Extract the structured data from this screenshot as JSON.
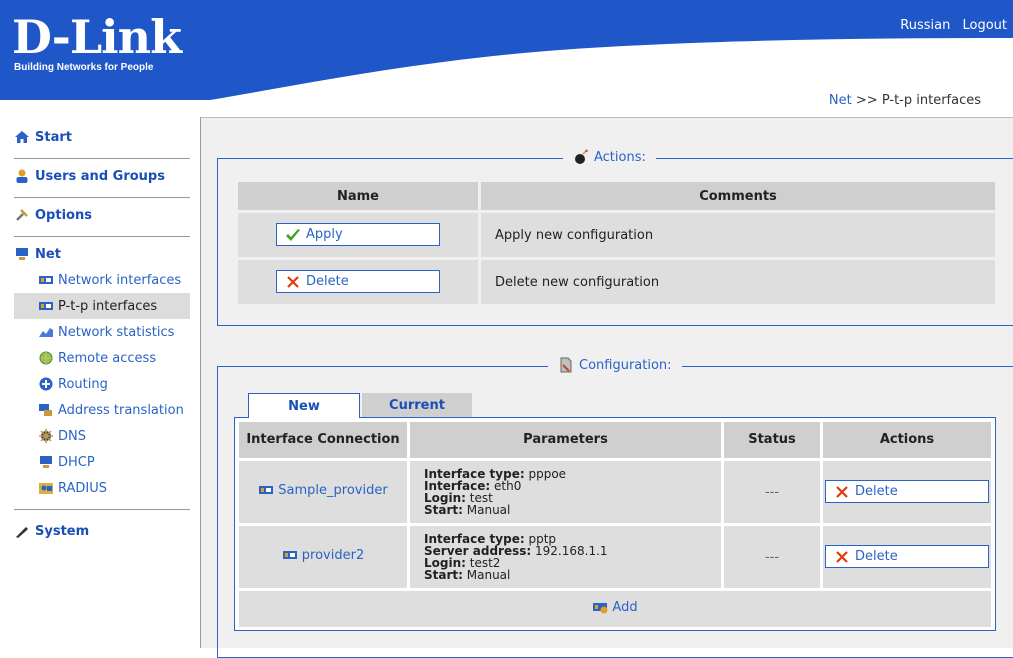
{
  "brand": {
    "name": "D-Link",
    "tagline": "Building Networks for People"
  },
  "top_links": {
    "language": "Russian",
    "logout": "Logout"
  },
  "breadcrumb": {
    "parent": "Net",
    "separator": ">>",
    "current": "P-t-p interfaces"
  },
  "sidebar": {
    "start": "Start",
    "users_groups": "Users and Groups",
    "options": "Options",
    "net": "Net",
    "net_items": [
      {
        "label": "Network interfaces",
        "icon": "network-card-icon"
      },
      {
        "label": "P-t-p interfaces",
        "icon": "network-card-icon",
        "active": true
      },
      {
        "label": "Network statistics",
        "icon": "chart-icon"
      },
      {
        "label": "Remote access",
        "icon": "globe-icon"
      },
      {
        "label": "Routing",
        "icon": "routing-icon"
      },
      {
        "label": "Address translation",
        "icon": "translate-icon"
      },
      {
        "label": "DNS",
        "icon": "dns-icon"
      },
      {
        "label": "DHCP",
        "icon": "dhcp-icon"
      },
      {
        "label": "RADIUS",
        "icon": "radius-icon"
      }
    ],
    "system": "System"
  },
  "actions": {
    "legend": "Actions:",
    "col_name": "Name",
    "col_comments": "Comments",
    "rows": [
      {
        "button": "Apply",
        "comment": "Apply new configuration",
        "icon": "checkmark-icon"
      },
      {
        "button": "Delete",
        "comment": "Delete new configuration",
        "icon": "cross-icon"
      }
    ]
  },
  "configuration": {
    "legend": "Configuration:",
    "tabs": [
      "New",
      "Current"
    ],
    "headers": [
      "Interface Connection",
      "Parameters",
      "Status",
      "Actions"
    ],
    "rows": [
      {
        "name": "Sample_provider",
        "params": [
          {
            "key": "Interface type:",
            "value": "pppoe"
          },
          {
            "key": "Interface:",
            "value": "eth0"
          },
          {
            "key": "Login:",
            "value": "test"
          },
          {
            "key": "Start:",
            "value": "Manual"
          }
        ],
        "status": "---",
        "action": "Delete"
      },
      {
        "name": "provider2",
        "params": [
          {
            "key": "Interface type:",
            "value": "pptp"
          },
          {
            "key": "Server address:",
            "value": "192.168.1.1"
          },
          {
            "key": "Login:",
            "value": "test2"
          },
          {
            "key": "Start:",
            "value": "Manual"
          }
        ],
        "status": "---",
        "action": "Delete"
      }
    ],
    "add_label": "Add"
  },
  "colors": {
    "header_blue": "#1f56c8",
    "link_blue": "#2a63c6",
    "panel_bg": "#f0f0f0"
  }
}
